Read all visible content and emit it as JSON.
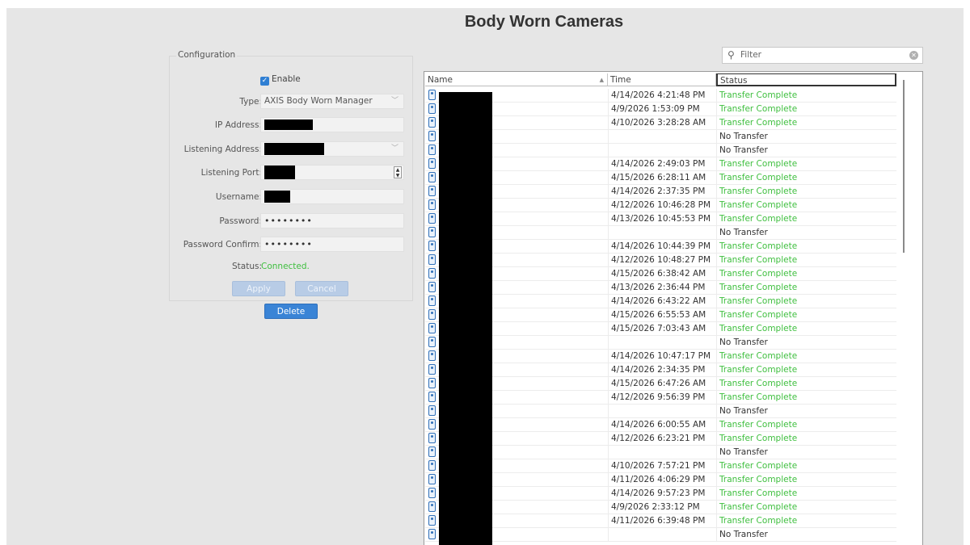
{
  "page": {
    "title": "Body Worn Cameras"
  },
  "config": {
    "legend": "Configuration",
    "enable_label": "Enable",
    "enable_checked": true,
    "type_label": "Type:",
    "type_value": "AXIS Body Worn Manager",
    "ip_label": "IP Address:",
    "listening_address_label": "Listening Address:",
    "listening_port_label": "Listening Port:",
    "username_label": "Username:",
    "password_label": "Password:",
    "password_value": "••••••••",
    "password_confirm_label": "Password Confirm:",
    "password_confirm_value": "••••••••",
    "status_label": "Status:",
    "status_value": "Connected.",
    "status_color": "#3fbf3f",
    "apply_label": "Apply",
    "cancel_label": "Cancel",
    "delete_label": "Delete"
  },
  "filter": {
    "placeholder": "Filter",
    "icon": "search-icon",
    "clear_icon": "clear-icon"
  },
  "table": {
    "columns": [
      "Name",
      "Time",
      "Status"
    ],
    "sorted_column": "Name",
    "ok_color": "#3fbf3f",
    "rows": [
      {
        "time": "4/14/2026 4:21:48 PM",
        "status": "Transfer Complete"
      },
      {
        "time": "4/9/2026 1:53:09 PM",
        "status": "Transfer Complete"
      },
      {
        "time": "4/10/2026 3:28:28 AM",
        "status": "Transfer Complete"
      },
      {
        "time": "",
        "status": "No Transfer"
      },
      {
        "time": "",
        "status": "No Transfer"
      },
      {
        "time": "4/14/2026 2:49:03 PM",
        "status": "Transfer Complete"
      },
      {
        "time": "4/15/2026 6:28:11 AM",
        "status": "Transfer Complete"
      },
      {
        "time": "4/14/2026 2:37:35 PM",
        "status": "Transfer Complete"
      },
      {
        "time": "4/12/2026 10:46:28 PM",
        "status": "Transfer Complete"
      },
      {
        "time": "4/13/2026 10:45:53 PM",
        "status": "Transfer Complete"
      },
      {
        "time": "",
        "status": "No Transfer"
      },
      {
        "time": "4/14/2026 10:44:39 PM",
        "status": "Transfer Complete"
      },
      {
        "time": "4/12/2026 10:48:27 PM",
        "status": "Transfer Complete"
      },
      {
        "time": "4/15/2026 6:38:42 AM",
        "status": "Transfer Complete"
      },
      {
        "time": "4/13/2026 2:36:44 PM",
        "status": "Transfer Complete"
      },
      {
        "time": "4/14/2026 6:43:22 AM",
        "status": "Transfer Complete"
      },
      {
        "time": "4/15/2026 6:55:53 AM",
        "status": "Transfer Complete"
      },
      {
        "time": "4/15/2026 7:03:43 AM",
        "status": "Transfer Complete"
      },
      {
        "time": "",
        "status": "No Transfer"
      },
      {
        "time": "4/14/2026 10:47:17 PM",
        "status": "Transfer Complete"
      },
      {
        "time": "4/14/2026 2:34:35 PM",
        "status": "Transfer Complete"
      },
      {
        "time": "4/15/2026 6:47:26 AM",
        "status": "Transfer Complete"
      },
      {
        "time": "4/12/2026 9:56:39 PM",
        "status": "Transfer Complete"
      },
      {
        "time": "",
        "status": "No Transfer"
      },
      {
        "time": "4/14/2026 6:00:55 AM",
        "status": "Transfer Complete"
      },
      {
        "time": "4/12/2026 6:23:21 PM",
        "status": "Transfer Complete"
      },
      {
        "time": "",
        "status": "No Transfer"
      },
      {
        "time": "4/10/2026 7:57:21 PM",
        "status": "Transfer Complete"
      },
      {
        "time": "4/11/2026 4:06:29 PM",
        "status": "Transfer Complete"
      },
      {
        "time": "4/14/2026 9:57:23 PM",
        "status": "Transfer Complete"
      },
      {
        "time": "4/9/2026 2:33:12 PM",
        "status": "Transfer Complete"
      },
      {
        "time": "4/11/2026 6:39:48 PM",
        "status": "Transfer Complete"
      },
      {
        "time": "",
        "status": "No Transfer"
      }
    ]
  }
}
